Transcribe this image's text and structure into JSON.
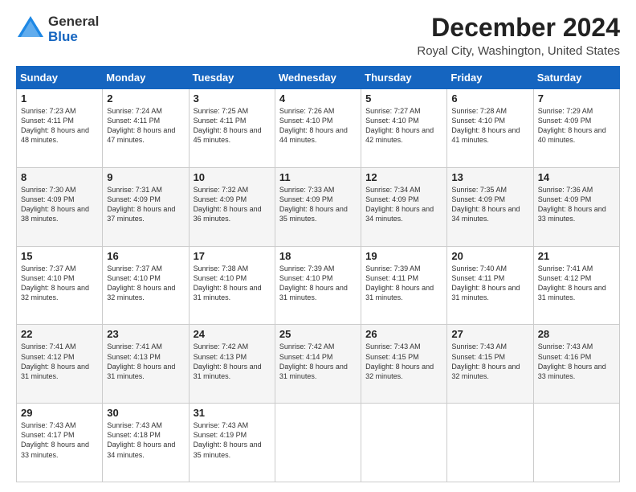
{
  "header": {
    "logo_general": "General",
    "logo_blue": "Blue",
    "title": "December 2024",
    "subtitle": "Royal City, Washington, United States"
  },
  "calendar": {
    "days": [
      "Sunday",
      "Monday",
      "Tuesday",
      "Wednesday",
      "Thursday",
      "Friday",
      "Saturday"
    ],
    "weeks": [
      [
        {
          "day": "1",
          "sunrise": "Sunrise: 7:23 AM",
          "sunset": "Sunset: 4:11 PM",
          "daylight": "Daylight: 8 hours and 48 minutes."
        },
        {
          "day": "2",
          "sunrise": "Sunrise: 7:24 AM",
          "sunset": "Sunset: 4:11 PM",
          "daylight": "Daylight: 8 hours and 47 minutes."
        },
        {
          "day": "3",
          "sunrise": "Sunrise: 7:25 AM",
          "sunset": "Sunset: 4:11 PM",
          "daylight": "Daylight: 8 hours and 45 minutes."
        },
        {
          "day": "4",
          "sunrise": "Sunrise: 7:26 AM",
          "sunset": "Sunset: 4:10 PM",
          "daylight": "Daylight: 8 hours and 44 minutes."
        },
        {
          "day": "5",
          "sunrise": "Sunrise: 7:27 AM",
          "sunset": "Sunset: 4:10 PM",
          "daylight": "Daylight: 8 hours and 42 minutes."
        },
        {
          "day": "6",
          "sunrise": "Sunrise: 7:28 AM",
          "sunset": "Sunset: 4:10 PM",
          "daylight": "Daylight: 8 hours and 41 minutes."
        },
        {
          "day": "7",
          "sunrise": "Sunrise: 7:29 AM",
          "sunset": "Sunset: 4:09 PM",
          "daylight": "Daylight: 8 hours and 40 minutes."
        }
      ],
      [
        {
          "day": "8",
          "sunrise": "Sunrise: 7:30 AM",
          "sunset": "Sunset: 4:09 PM",
          "daylight": "Daylight: 8 hours and 38 minutes."
        },
        {
          "day": "9",
          "sunrise": "Sunrise: 7:31 AM",
          "sunset": "Sunset: 4:09 PM",
          "daylight": "Daylight: 8 hours and 37 minutes."
        },
        {
          "day": "10",
          "sunrise": "Sunrise: 7:32 AM",
          "sunset": "Sunset: 4:09 PM",
          "daylight": "Daylight: 8 hours and 36 minutes."
        },
        {
          "day": "11",
          "sunrise": "Sunrise: 7:33 AM",
          "sunset": "Sunset: 4:09 PM",
          "daylight": "Daylight: 8 hours and 35 minutes."
        },
        {
          "day": "12",
          "sunrise": "Sunrise: 7:34 AM",
          "sunset": "Sunset: 4:09 PM",
          "daylight": "Daylight: 8 hours and 34 minutes."
        },
        {
          "day": "13",
          "sunrise": "Sunrise: 7:35 AM",
          "sunset": "Sunset: 4:09 PM",
          "daylight": "Daylight: 8 hours and 34 minutes."
        },
        {
          "day": "14",
          "sunrise": "Sunrise: 7:36 AM",
          "sunset": "Sunset: 4:09 PM",
          "daylight": "Daylight: 8 hours and 33 minutes."
        }
      ],
      [
        {
          "day": "15",
          "sunrise": "Sunrise: 7:37 AM",
          "sunset": "Sunset: 4:10 PM",
          "daylight": "Daylight: 8 hours and 32 minutes."
        },
        {
          "day": "16",
          "sunrise": "Sunrise: 7:37 AM",
          "sunset": "Sunset: 4:10 PM",
          "daylight": "Daylight: 8 hours and 32 minutes."
        },
        {
          "day": "17",
          "sunrise": "Sunrise: 7:38 AM",
          "sunset": "Sunset: 4:10 PM",
          "daylight": "Daylight: 8 hours and 31 minutes."
        },
        {
          "day": "18",
          "sunrise": "Sunrise: 7:39 AM",
          "sunset": "Sunset: 4:10 PM",
          "daylight": "Daylight: 8 hours and 31 minutes."
        },
        {
          "day": "19",
          "sunrise": "Sunrise: 7:39 AM",
          "sunset": "Sunset: 4:11 PM",
          "daylight": "Daylight: 8 hours and 31 minutes."
        },
        {
          "day": "20",
          "sunrise": "Sunrise: 7:40 AM",
          "sunset": "Sunset: 4:11 PM",
          "daylight": "Daylight: 8 hours and 31 minutes."
        },
        {
          "day": "21",
          "sunrise": "Sunrise: 7:41 AM",
          "sunset": "Sunset: 4:12 PM",
          "daylight": "Daylight: 8 hours and 31 minutes."
        }
      ],
      [
        {
          "day": "22",
          "sunrise": "Sunrise: 7:41 AM",
          "sunset": "Sunset: 4:12 PM",
          "daylight": "Daylight: 8 hours and 31 minutes."
        },
        {
          "day": "23",
          "sunrise": "Sunrise: 7:41 AM",
          "sunset": "Sunset: 4:13 PM",
          "daylight": "Daylight: 8 hours and 31 minutes."
        },
        {
          "day": "24",
          "sunrise": "Sunrise: 7:42 AM",
          "sunset": "Sunset: 4:13 PM",
          "daylight": "Daylight: 8 hours and 31 minutes."
        },
        {
          "day": "25",
          "sunrise": "Sunrise: 7:42 AM",
          "sunset": "Sunset: 4:14 PM",
          "daylight": "Daylight: 8 hours and 31 minutes."
        },
        {
          "day": "26",
          "sunrise": "Sunrise: 7:43 AM",
          "sunset": "Sunset: 4:15 PM",
          "daylight": "Daylight: 8 hours and 32 minutes."
        },
        {
          "day": "27",
          "sunrise": "Sunrise: 7:43 AM",
          "sunset": "Sunset: 4:15 PM",
          "daylight": "Daylight: 8 hours and 32 minutes."
        },
        {
          "day": "28",
          "sunrise": "Sunrise: 7:43 AM",
          "sunset": "Sunset: 4:16 PM",
          "daylight": "Daylight: 8 hours and 33 minutes."
        }
      ],
      [
        {
          "day": "29",
          "sunrise": "Sunrise: 7:43 AM",
          "sunset": "Sunset: 4:17 PM",
          "daylight": "Daylight: 8 hours and 33 minutes."
        },
        {
          "day": "30",
          "sunrise": "Sunrise: 7:43 AM",
          "sunset": "Sunset: 4:18 PM",
          "daylight": "Daylight: 8 hours and 34 minutes."
        },
        {
          "day": "31",
          "sunrise": "Sunrise: 7:43 AM",
          "sunset": "Sunset: 4:19 PM",
          "daylight": "Daylight: 8 hours and 35 minutes."
        },
        null,
        null,
        null,
        null
      ]
    ]
  }
}
